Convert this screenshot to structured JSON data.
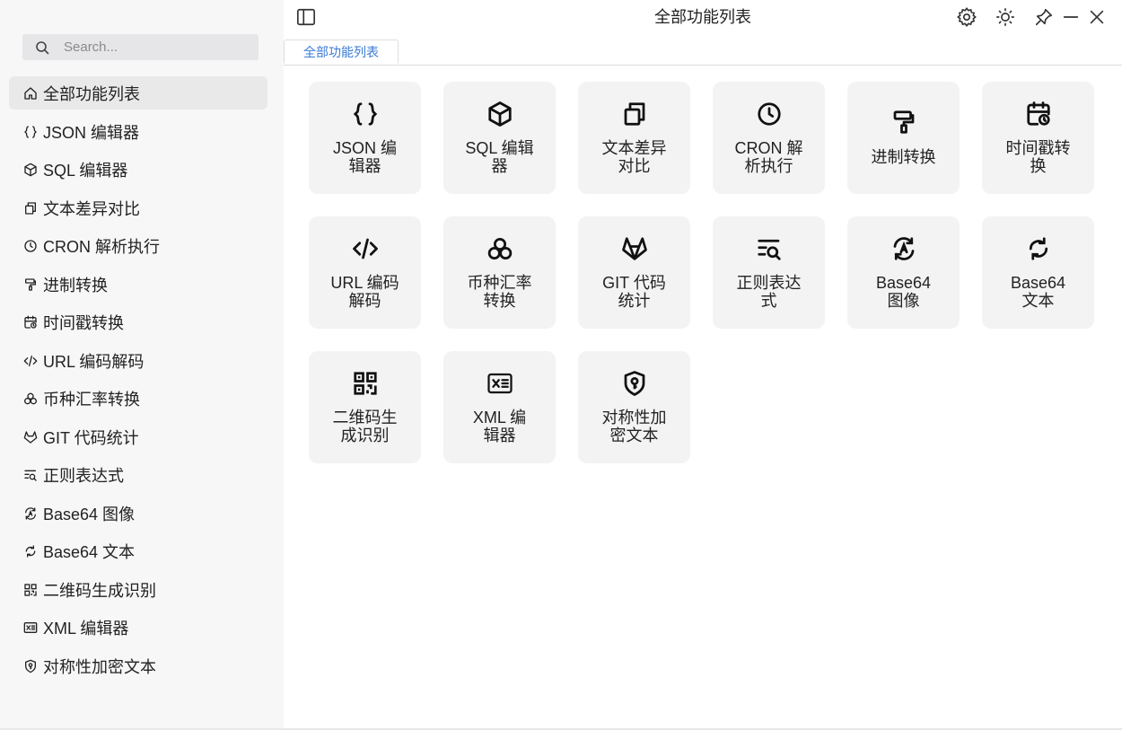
{
  "window": {
    "title": "全部功能列表"
  },
  "search": {
    "placeholder": "Search..."
  },
  "tab": {
    "label": "全部功能列表"
  },
  "sidebar": {
    "items": [
      {
        "label": "全部功能列表",
        "icon": "home-icon",
        "active": true
      },
      {
        "label": "JSON 编辑器",
        "icon": "braces-icon"
      },
      {
        "label": "SQL 编辑器",
        "icon": "cube-icon"
      },
      {
        "label": "文本差异对比",
        "icon": "copy-icon"
      },
      {
        "label": "CRON 解析执行",
        "icon": "clock-icon"
      },
      {
        "label": "进制转换",
        "icon": "paint-roller-icon"
      },
      {
        "label": "时间戳转换",
        "icon": "calendar-clock-icon"
      },
      {
        "label": "URL 编码解码",
        "icon": "code-icon"
      },
      {
        "label": "币种汇率转换",
        "icon": "coins-icon"
      },
      {
        "label": "GIT 代码统计",
        "icon": "gitlab-icon"
      },
      {
        "label": "正则表达式",
        "icon": "text-search-icon"
      },
      {
        "label": "Base64 图像",
        "icon": "refresh-a-icon"
      },
      {
        "label": "Base64 文本",
        "icon": "refresh-icon"
      },
      {
        "label": "二维码生成识别",
        "icon": "qrcode-icon"
      },
      {
        "label": "XML 编辑器",
        "icon": "xml-file-icon"
      },
      {
        "label": "对称性加密文本",
        "icon": "shield-key-icon"
      }
    ]
  },
  "cards": [
    {
      "line1": "JSON 编",
      "line2": "辑器",
      "icon": "braces-icon"
    },
    {
      "line1": "SQL 编辑",
      "line2": "器",
      "icon": "cube-icon"
    },
    {
      "line1": "文本差异",
      "line2": "对比",
      "icon": "copy-icon"
    },
    {
      "line1": "CRON 解",
      "line2": "析执行",
      "icon": "clock-icon"
    },
    {
      "line1": "进制转换",
      "line2": "",
      "icon": "paint-roller-icon"
    },
    {
      "line1": "时间戳转",
      "line2": "换",
      "icon": "calendar-clock-icon"
    },
    {
      "line1": "URL 编码",
      "line2": "解码",
      "icon": "code-icon"
    },
    {
      "line1": "币种汇率",
      "line2": "转换",
      "icon": "coins-icon"
    },
    {
      "line1": "GIT 代码",
      "line2": "统计",
      "icon": "gitlab-icon"
    },
    {
      "line1": "正则表达",
      "line2": "式",
      "icon": "text-search-icon"
    },
    {
      "line1": "Base64",
      "line2": "图像",
      "icon": "refresh-a-icon"
    },
    {
      "line1": "Base64",
      "line2": "文本",
      "icon": "refresh-icon"
    },
    {
      "line1": "二维码生",
      "line2": "成识别",
      "icon": "qrcode-icon"
    },
    {
      "line1": "XML 编",
      "line2": "辑器",
      "icon": "xml-file-icon"
    },
    {
      "line1": "对称性加",
      "line2": "密文本",
      "icon": "shield-key-icon"
    }
  ],
  "colors": {
    "accent": "#3a7bd5",
    "card_bg": "#f3f3f3",
    "sidebar_bg": "#f7f7f7"
  }
}
